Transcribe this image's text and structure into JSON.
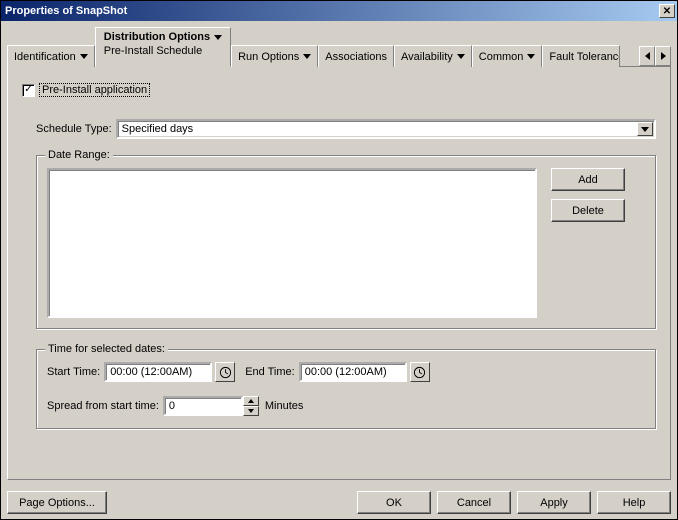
{
  "window": {
    "title": "Properties of SnapShot"
  },
  "tabs": {
    "identification": "Identification",
    "distribution": "Distribution Options",
    "distribution_sub": "Pre-Install Schedule",
    "run": "Run Options",
    "associations": "Associations",
    "availability": "Availability",
    "common": "Common",
    "fault_tolerance": "Fault Tolerance"
  },
  "preinstall": {
    "checkbox_label": "Pre-Install application"
  },
  "schedule_type": {
    "label": "Schedule Type:",
    "value": "Specified days"
  },
  "date_range": {
    "legend": "Date Range:",
    "add": "Add",
    "delete": "Delete"
  },
  "time": {
    "legend": "Time for selected dates:",
    "start_label": "Start Time:",
    "start_value": "00:00 (12:00AM)",
    "end_label": "End Time:",
    "end_value": "00:00 (12:00AM)",
    "spread_label": "Spread from start time:",
    "spread_value": "0",
    "spread_unit": "Minutes"
  },
  "buttons": {
    "page_options": "Page Options...",
    "ok": "OK",
    "cancel": "Cancel",
    "apply": "Apply",
    "help": "Help"
  }
}
